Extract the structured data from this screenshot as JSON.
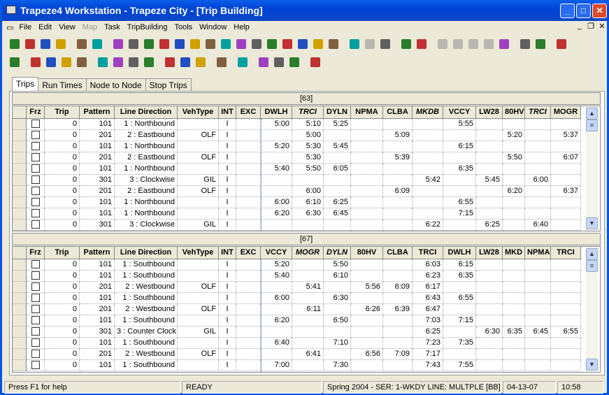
{
  "window": {
    "title": "Trapeze4 Workstation - Trapeze City - [Trip Building]"
  },
  "menu": [
    {
      "label": "File",
      "enabled": true
    },
    {
      "label": "Edit",
      "enabled": true
    },
    {
      "label": "View",
      "enabled": true
    },
    {
      "label": "Map",
      "enabled": false
    },
    {
      "label": "Task",
      "enabled": true
    },
    {
      "label": "TripBuilding",
      "enabled": true
    },
    {
      "label": "Tools",
      "enabled": true
    },
    {
      "label": "Window",
      "enabled": true
    },
    {
      "label": "Help",
      "enabled": true
    }
  ],
  "toolbar1": [
    "globe-icon",
    "globe-network-icon",
    "map-route-icon",
    "sparkle-icon",
    "bank-icon",
    "stop-sign-icon",
    "bus-stop-icon",
    "grid-icon",
    "windows-icon",
    "tiles-icon",
    "table-icon",
    "note-icon",
    "list-icon",
    "check-icon",
    "people-icon",
    "run-icon",
    "people-group-icon",
    "bus-icon",
    "bus-schedule-icon",
    "calendar-icon",
    "report-icon",
    "magnify-map-icon",
    "map-zoom-icon",
    "chart-edit-icon",
    "pin-icon",
    "play-icon",
    "draw-disabled-icon",
    "zoom-in-icon",
    "zoom-out-icon",
    "ruler-icon",
    "layers-icon",
    "printer-map-icon",
    "tree-icon",
    "help-icon"
  ],
  "toolbar2": [
    "exit-icon",
    "first-record-icon",
    "previous-record-icon",
    "next-record-icon",
    "last-record-icon",
    "edit-icon",
    "save-icon",
    "cancel-icon",
    "delete-icon",
    "sort-up-icon",
    "sort-down-icon",
    "copy-icon",
    "filter-icon",
    "print-icon",
    "pointer-icon",
    "pointer-select-icon",
    "color-icon",
    "info-icon"
  ],
  "tabs": [
    {
      "label": "Trips",
      "active": true
    },
    {
      "label": "Run Times",
      "active": false
    },
    {
      "label": "Node to Node",
      "active": false
    },
    {
      "label": "Stop Trips",
      "active": false
    }
  ],
  "top": {
    "group": "[63]",
    "columns": [
      "Frz",
      "Trip",
      "Pattern",
      "Line Direction",
      "VehType",
      "INT",
      "EXC",
      "DWLH",
      "TRCI",
      "DYLN",
      "NPMA",
      "CLBA",
      "MKDB",
      "VCCY",
      "LW28",
      "80HV",
      "TRCI",
      "MOGR"
    ],
    "italic": [
      "TRCI",
      "MKDB"
    ],
    "rows": [
      [
        "",
        "0",
        "101",
        "1 : Northbound",
        "",
        "I",
        "",
        "5:00",
        "5:10",
        "5:25",
        "",
        "",
        "",
        "5:55",
        "",
        "",
        "",
        ""
      ],
      [
        "",
        "0",
        "201",
        "2 : Eastbound",
        "OLF",
        "I",
        "",
        "",
        "5:00",
        "",
        "",
        "5:09",
        "",
        "",
        "",
        "5:20",
        "",
        "5:37"
      ],
      [
        "",
        "0",
        "101",
        "1 : Northbound",
        "",
        "I",
        "",
        "5:20",
        "5:30",
        "5:45",
        "",
        "",
        "",
        "6:15",
        "",
        "",
        "",
        ""
      ],
      [
        "",
        "0",
        "201",
        "2 : Eastbound",
        "OLF",
        "I",
        "",
        "",
        "5:30",
        "",
        "",
        "5:39",
        "",
        "",
        "",
        "5:50",
        "",
        "6:07"
      ],
      [
        "",
        "0",
        "101",
        "1 : Northbound",
        "",
        "I",
        "",
        "5:40",
        "5:50",
        "6:05",
        "",
        "",
        "",
        "6:35",
        "",
        "",
        "",
        ""
      ],
      [
        "",
        "0",
        "301",
        "3 : Clockwise",
        "GIL",
        "I",
        "",
        "",
        "",
        "",
        "",
        "",
        "5:42",
        "",
        "5:45",
        "",
        "6:00",
        ""
      ],
      [
        "",
        "0",
        "201",
        "2 : Eastbound",
        "OLF",
        "I",
        "",
        "",
        "6:00",
        "",
        "",
        "6:09",
        "",
        "",
        "",
        "6:20",
        "",
        "6:37"
      ],
      [
        "",
        "0",
        "101",
        "1 : Northbound",
        "",
        "I",
        "",
        "6:00",
        "6:10",
        "6:25",
        "",
        "",
        "",
        "6:55",
        "",
        "",
        "",
        ""
      ],
      [
        "",
        "0",
        "101",
        "1 : Northbound",
        "",
        "I",
        "",
        "6:20",
        "6:30",
        "6:45",
        "",
        "",
        "",
        "7:15",
        "",
        "",
        "",
        ""
      ],
      [
        "",
        "0",
        "301",
        "3 : Clockwise",
        "GIL",
        "I",
        "",
        "",
        "",
        "",
        "",
        "",
        "6:22",
        "",
        "6:25",
        "",
        "6:40",
        ""
      ]
    ]
  },
  "bottom": {
    "group": "[67]",
    "columns": [
      "Frz",
      "Trip",
      "Pattern",
      "Line Direction",
      "VehType",
      "INT",
      "EXC",
      "VCCY",
      "MOGR",
      "DYLN",
      "80HV",
      "CLBA",
      "TRCI",
      "DWLH",
      "LW28",
      "MKD",
      "NPMA",
      "TRCI"
    ],
    "italic": [
      "MOGR",
      "DYLN"
    ],
    "rows": [
      [
        "",
        "0",
        "101",
        "1 : Southbound",
        "",
        "I",
        "",
        "5:20",
        "",
        "5:50",
        "",
        "",
        "6:03",
        "6:15",
        "",
        "",
        "",
        ""
      ],
      [
        "",
        "0",
        "101",
        "1 : Southbound",
        "",
        "I",
        "",
        "5:40",
        "",
        "6:10",
        "",
        "",
        "6:23",
        "6:35",
        "",
        "",
        "",
        ""
      ],
      [
        "",
        "0",
        "201",
        "2 : Westbound",
        "OLF",
        "I",
        "",
        "",
        "5:41",
        "",
        "5:56",
        "6:09",
        "6:17",
        "",
        "",
        "",
        "",
        ""
      ],
      [
        "",
        "0",
        "101",
        "1 : Southbound",
        "",
        "I",
        "",
        "6:00",
        "",
        "6:30",
        "",
        "",
        "6:43",
        "6:55",
        "",
        "",
        "",
        ""
      ],
      [
        "",
        "0",
        "201",
        "2 : Westbound",
        "OLF",
        "I",
        "",
        "",
        "6:11",
        "",
        "6:26",
        "6:39",
        "6:47",
        "",
        "",
        "",
        "",
        ""
      ],
      [
        "",
        "0",
        "101",
        "1 : Southbound",
        "",
        "I",
        "",
        "6:20",
        "",
        "6:50",
        "",
        "",
        "7:03",
        "7:15",
        "",
        "",
        "",
        ""
      ],
      [
        "",
        "0",
        "301",
        "3 : Counter Clock",
        "GIL",
        "I",
        "",
        "",
        "",
        "",
        "",
        "",
        "6:25",
        "",
        "6:30",
        "6:35",
        "6:45",
        "6:55"
      ],
      [
        "",
        "0",
        "101",
        "1 : Southbound",
        "",
        "I",
        "",
        "6:40",
        "",
        "7:10",
        "",
        "",
        "7:23",
        "7:35",
        "",
        "",
        "",
        ""
      ],
      [
        "",
        "0",
        "201",
        "2 : Westbound",
        "OLF",
        "I",
        "",
        "",
        "6:41",
        "",
        "6:56",
        "7:09",
        "7:17",
        "",
        "",
        "",
        "",
        ""
      ],
      [
        "",
        "0",
        "101",
        "1 : Southbound",
        "",
        "I",
        "",
        "7:00",
        "",
        "7:30",
        "",
        "",
        "7:43",
        "7:55",
        "",
        "",
        "",
        ""
      ]
    ]
  },
  "status": {
    "help": "Press F1 for help",
    "state": "READY",
    "context": "Spring 2004 - SER: 1-WKDY  LINE: MULTPLE [BB]",
    "date": "04-13-07",
    "time": "10:58"
  },
  "colors": {
    "titlebar": "#0054e3",
    "accent": "#0a246a"
  }
}
